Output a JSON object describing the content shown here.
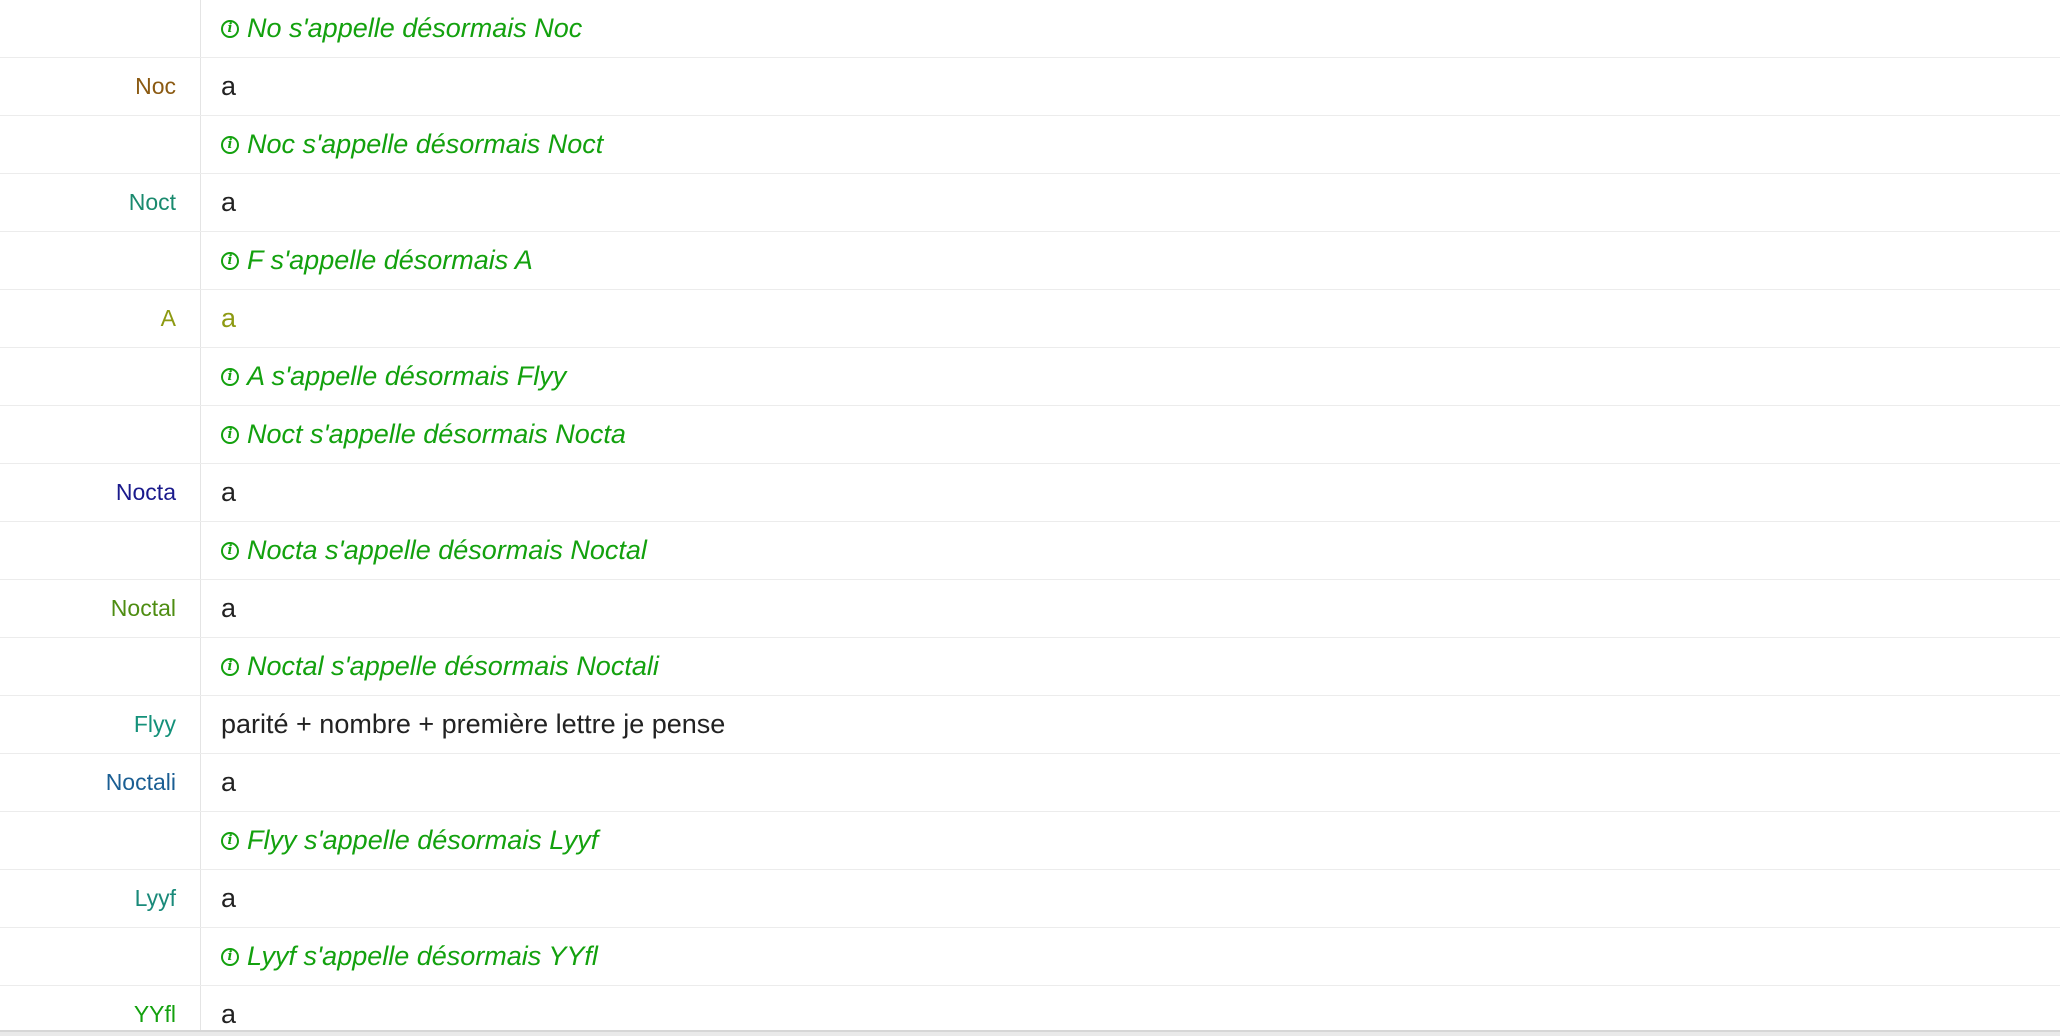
{
  "colors": {
    "system_text": "#13a10e",
    "message_text": "#222222",
    "divider": "#ececec"
  },
  "rows": [
    {
      "type": "system",
      "text": "No s'appelle désormais Noc"
    },
    {
      "type": "message",
      "nick": "Noc",
      "nick_color": "#8b5a12",
      "text": "a",
      "text_color": "#222222"
    },
    {
      "type": "system",
      "text": "Noc s'appelle désormais Noct"
    },
    {
      "type": "message",
      "nick": "Noct",
      "nick_color": "#1a8a6e",
      "text": "a",
      "text_color": "#222222"
    },
    {
      "type": "system",
      "text": "F s'appelle désormais A"
    },
    {
      "type": "message",
      "nick": "A",
      "nick_color": "#8d9a12",
      "text": "a",
      "text_color": "#8d9a12"
    },
    {
      "type": "system",
      "text": "A s'appelle désormais Flyy"
    },
    {
      "type": "system",
      "text": "Noct s'appelle désormais Nocta"
    },
    {
      "type": "message",
      "nick": "Nocta",
      "nick_color": "#1a1a8c",
      "text": "a",
      "text_color": "#222222"
    },
    {
      "type": "system",
      "text": "Nocta s'appelle désormais Noctal"
    },
    {
      "type": "message",
      "nick": "Noctal",
      "nick_color": "#4e8d12",
      "text": "a",
      "text_color": "#222222"
    },
    {
      "type": "system",
      "text": "Noctal s'appelle désormais Noctali"
    },
    {
      "type": "message",
      "nick": "Flyy",
      "nick_color": "#14917a",
      "text": "parité + nombre + première lettre je pense",
      "text_color": "#222222"
    },
    {
      "type": "message",
      "nick": "Noctali",
      "nick_color": "#1a5e93",
      "text": "a",
      "text_color": "#222222"
    },
    {
      "type": "system",
      "text": "Flyy s'appelle désormais Lyyf"
    },
    {
      "type": "message",
      "nick": "Lyyf",
      "nick_color": "#1a8a7a",
      "text": "a",
      "text_color": "#222222"
    },
    {
      "type": "system",
      "text": "Lyyf s'appelle désormais YYfl"
    },
    {
      "type": "message",
      "nick": "YYfl",
      "nick_color": "#13a10e",
      "text": "a",
      "text_color": "#222222"
    }
  ]
}
